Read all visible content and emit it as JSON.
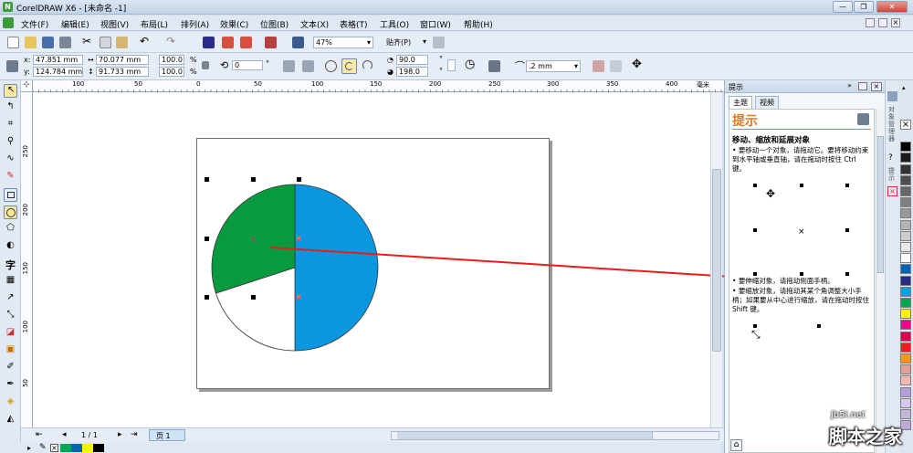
{
  "window": {
    "title": "CorelDRAW X6 - [未命名 -1]",
    "app_icon": "coreldraw-app-icon"
  },
  "menu": [
    "文件(F)",
    "编辑(E)",
    "视图(V)",
    "布局(L)",
    "排列(A)",
    "效果(C)",
    "位图(B)",
    "文本(X)",
    "表格(T)",
    "工具(O)",
    "窗口(W)",
    "帮助(H)"
  ],
  "toolbar": {
    "zoom": "47%",
    "snap": "贴齐(P)"
  },
  "propbar": {
    "x_label": "x:",
    "x": "47.851 mm",
    "y_label": "y:",
    "y": "124.784 mm",
    "w": "70.077 mm",
    "h": "91.733 mm",
    "sx": "100.0",
    "sy": "100.0",
    "pct": "%",
    "angle": "0",
    "deg": "°",
    "start_angle": "90.0",
    "end_angle": "198.0",
    "outline": ".2 mm"
  },
  "ruler": {
    "h_ticks": [
      "100",
      "50",
      "0",
      "50",
      "100",
      "150",
      "200",
      "250",
      "300",
      "350",
      "400"
    ],
    "v_ticks": [
      "250",
      "200",
      "150",
      "100",
      "50"
    ],
    "unit": "毫米"
  },
  "pie": {
    "colors": {
      "green": "#079a3e",
      "blue": "#0a97e0",
      "white": "#ffffff"
    },
    "start_angle": 90.0,
    "end_angle": 198.0
  },
  "pagenav": {
    "counter": "1 / 1",
    "page_tab": "页 1"
  },
  "docker": {
    "title": "提示",
    "tabs": [
      "主题",
      "视频"
    ],
    "heading": "提示",
    "section_title": "移动、缩放和延展对象",
    "bullet1": "要移动一个对象，请拖动它。要将移动约束到水平轴或垂直轴，请在拖动时按住 Ctrl 键。",
    "bullet2": "要缩放对象，请拖动其某个角调整大小手柄；如果要从中心进行缩放，请在拖动时按住 Shift 键。",
    "bullet_partial": "要伸缩对象，请拖动侧面手柄。"
  },
  "side_tabs": [
    "对象管理器",
    "提示"
  ],
  "palette": [
    "#ffffff",
    "#000000",
    "#1a1a1a",
    "#333333",
    "#4d4d4d",
    "#666666",
    "#808080",
    "#999999",
    "#b3b3b3",
    "#cccccc",
    "#e6e6e6",
    "#ffffff",
    "#0066b3",
    "#2a2a8a",
    "#00a3e0",
    "#00a651",
    "#fff200",
    "#ec008c",
    "#d8004e",
    "#ed1c24",
    "#f7941d",
    "#e2a098",
    "#f4b6b0",
    "#b39ddb",
    "#d5c8e8",
    "#c4b7dc",
    "#bfa9d6"
  ],
  "bottom_colors": [
    "#ffffff",
    "#00a651",
    "#0066b3",
    "#fff200",
    "#000000"
  ],
  "watermark": {
    "url": "jb5l.net",
    "text": "脚本之家"
  }
}
